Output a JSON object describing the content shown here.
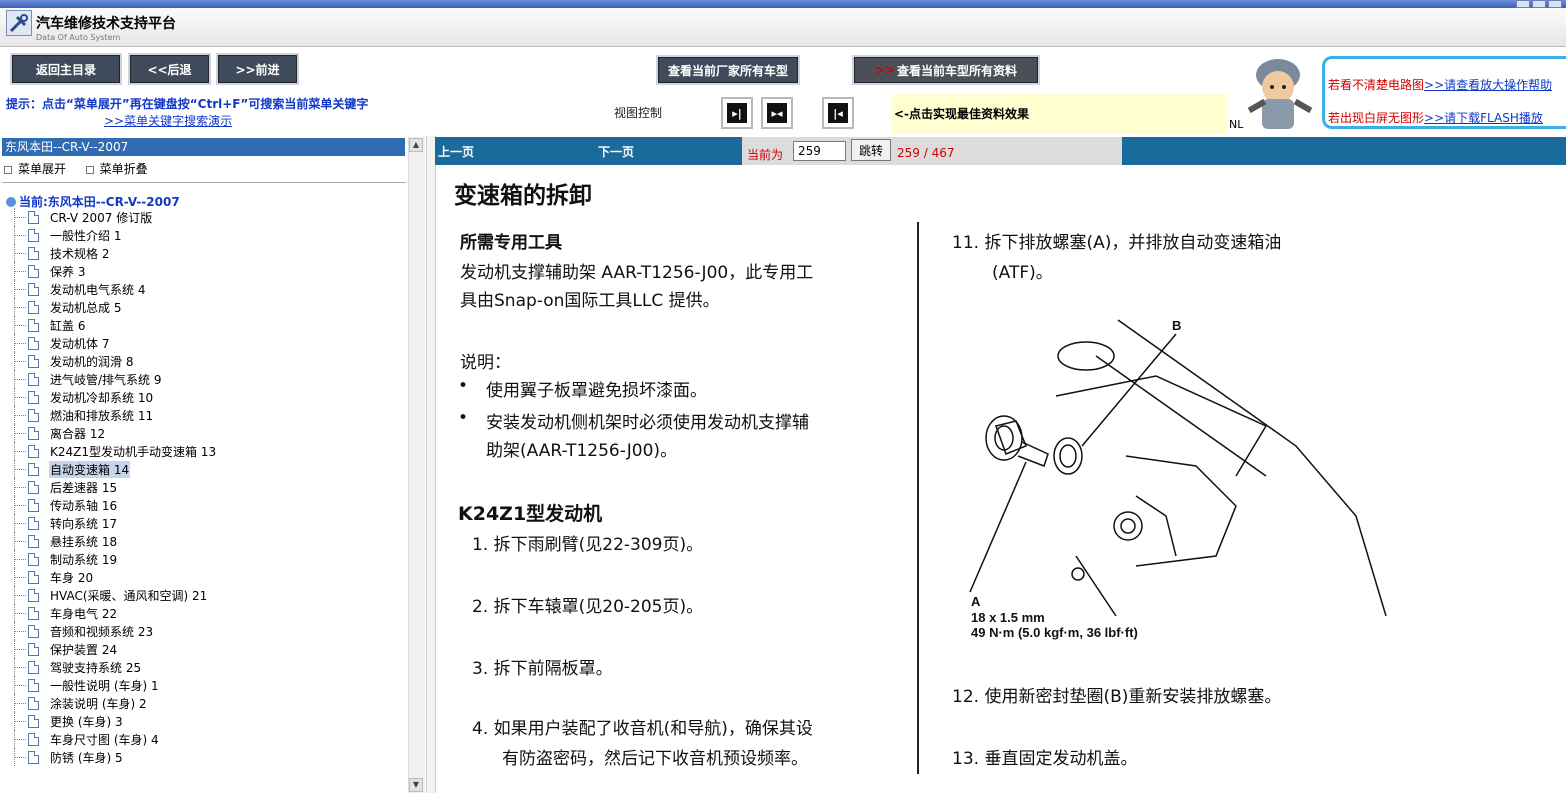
{
  "app": {
    "title": "汽车维修技术支持平台",
    "subtitle": "Data Of Auto System"
  },
  "toolbar": {
    "home_label": "返回主目录",
    "back_label": "<<后退",
    "forward_label": ">>前进",
    "maker_models_label": "查看当前厂家所有车型",
    "all_docs_icon": ">>",
    "all_docs_label": "查看当前车型所有资料"
  },
  "hint": {
    "text": "提示：点击“菜单展开”再在键盘按“Ctrl+F”可搜索当前菜单关键字",
    "link": ">>菜单关键字搜索演示"
  },
  "view_control": {
    "label": "视图控制",
    "tip": "<-点击实现最佳资料效果"
  },
  "help_panel": {
    "line1_red": "若看不清楚电路图",
    "line1_link": ">>请查看放大操作帮助",
    "line2_red": "若出现白屏无图形",
    "line2_link": ">>请下载FLASH播放",
    "nl_text": "NL"
  },
  "sidebar": {
    "header": "东风本田--CR-V--2007",
    "expand_label": "菜单展开",
    "collapse_label": "菜单折叠",
    "root_label": "当前:东风本田--CR-V--2007",
    "items": [
      {
        "label": "CR-V 2007 修订版"
      },
      {
        "label": "一般性介绍  1"
      },
      {
        "label": "技术规格  2"
      },
      {
        "label": "保养  3"
      },
      {
        "label": "发动机电气系统  4"
      },
      {
        "label": "发动机总成  5"
      },
      {
        "label": "缸盖  6"
      },
      {
        "label": "发动机体  7"
      },
      {
        "label": "发动机的润滑  8"
      },
      {
        "label": "进气岐管/排气系统  9"
      },
      {
        "label": "发动机冷却系统  10"
      },
      {
        "label": "燃油和排放系统  11"
      },
      {
        "label": "离合器  12"
      },
      {
        "label": "K24Z1型发动机手动变速箱  13"
      },
      {
        "label": "自动变速箱  14",
        "selected": true
      },
      {
        "label": "后差速器  15"
      },
      {
        "label": "传动系轴  16"
      },
      {
        "label": "转向系统  17"
      },
      {
        "label": "悬挂系统  18"
      },
      {
        "label": "制动系统  19"
      },
      {
        "label": "车身  20"
      },
      {
        "label": "HVAC(采暖、通风和空调) 21"
      },
      {
        "label": "车身电气  22"
      },
      {
        "label": "音频和视频系统  23"
      },
      {
        "label": "保护装置  24"
      },
      {
        "label": "驾驶支持系统  25"
      },
      {
        "label": "一般性说明 (车身) 1"
      },
      {
        "label": "涂装说明 (车身) 2"
      },
      {
        "label": "更换 (车身) 3"
      },
      {
        "label": "车身尺寸图 (车身) 4"
      },
      {
        "label": "防锈 (车身) 5"
      }
    ]
  },
  "pager": {
    "prev_label": "上一页",
    "next_label": "下一页",
    "current_label": "当前为",
    "current_value": "259",
    "jump_label": "跳转",
    "count_text": "259 / 467"
  },
  "document": {
    "title": "变速箱的拆卸",
    "tools_heading": "所需专用工具",
    "tools_line1": "发动机支撑辅助架 AAR-T1256-J00，此专用工",
    "tools_line2": "具由Snap-on国际工具LLC 提供。",
    "notes_heading": "说明：",
    "note1": "使用翼子板罩避免损坏漆面。",
    "note2_line1": "安装发动机侧机架时必须使用发动机支撑辅",
    "note2_line2": "助架(AAR-T1256-J00)。",
    "engine_heading": "K24Z1型发动机",
    "step1": "1.  拆下雨刷臂(见22-309页)。",
    "step2": "2.  拆下车辕罩(见20-205页)。",
    "step3": "3.  拆下前隔板罩。",
    "step4_line1": "4.  如果用户装配了收音机(和导航)，确保其设",
    "step4_line2": "有防盗密码，然后记下收音机预设频率。",
    "step11_line1": "11.  拆下排放螺塞(A)，并排放自动变速箱油",
    "step11_line2": "(ATF)。",
    "diagram_label_b": "B",
    "diagram_label_a": "A",
    "diagram_spec1": "18 x 1.5 mm",
    "diagram_spec2": "49 N·m (5.0 kgf·m, 36 lbf·ft)",
    "step12": "12.  使用新密封垫圈(B)重新安装排放螺塞。",
    "step13": "13.  垂直固定发动机盖。"
  }
}
